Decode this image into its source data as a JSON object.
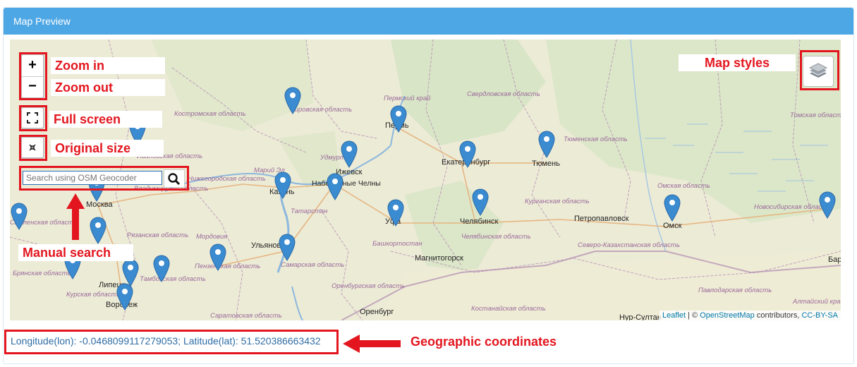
{
  "panel": {
    "title": "Map Preview"
  },
  "controls": {
    "zoom_in": "+",
    "zoom_out": "−",
    "fullscreen_icon": "fullscreen-icon",
    "original_size_icon": "collapse-icon",
    "layers_icon": "layers-icon",
    "search_placeholder": "Search using OSM Geocoder",
    "search_icon": "search-icon"
  },
  "annotations": {
    "zoom_in": "Zoom in",
    "zoom_out": "Zoom out",
    "full_screen": "Full screen",
    "original_size": "Original size",
    "manual_search": "Manual search",
    "map_styles": "Map styles",
    "geographic_coordinates": "Geographic coordinates"
  },
  "map": {
    "cities": [
      "Москва",
      "Казань",
      "Набережные Челны",
      "Ижевск",
      "Пермь",
      "Екатеринбург",
      "Тюмень",
      "Уфа",
      "Челябинск",
      "Петропавловск",
      "Омск",
      "Магнитогорск",
      "Ульяновск",
      "Воронеж",
      "Липецк",
      "Оренбург",
      "Нур-Султан",
      "Барнаул"
    ],
    "regions": [
      "Костромская область",
      "Ивановская область",
      "Владимирская область",
      "Нижегородская область",
      "Кировская область",
      "Пермский край",
      "Свердловская область",
      "Удмуртия",
      "Марий Эл",
      "Татарстан",
      "Тюменская область",
      "Томская область",
      "Омская область",
      "Курганская область",
      "Новосибирская область",
      "Челябинская область",
      "Башкортостан",
      "Самарская область",
      "Пензенская область",
      "Рязанская область",
      "Мордовия",
      "Тамбовская область",
      "Брянская область",
      "Курская область",
      "Оренбургская область",
      "Саратовская область",
      "Северо-Казахстанская область",
      "Костанайская область",
      "Павлодарская область",
      "Алтайский край",
      "Смоленская область"
    ],
    "marker_color": "#3b8bd0",
    "attribution": {
      "leaflet": "Leaflet",
      "separator": " | © ",
      "osm": "OpenStreetMap",
      "contributors": " contributors, ",
      "license": "CC-BY-SA"
    }
  },
  "coordinates": {
    "text": "Longitude(lon): -0.0468099117279053; Latitude(lat): 51.520386663432"
  },
  "colors": {
    "header": "#4ea7e5",
    "annotation_red": "#e3161f",
    "coords_text": "#2e6da4"
  }
}
